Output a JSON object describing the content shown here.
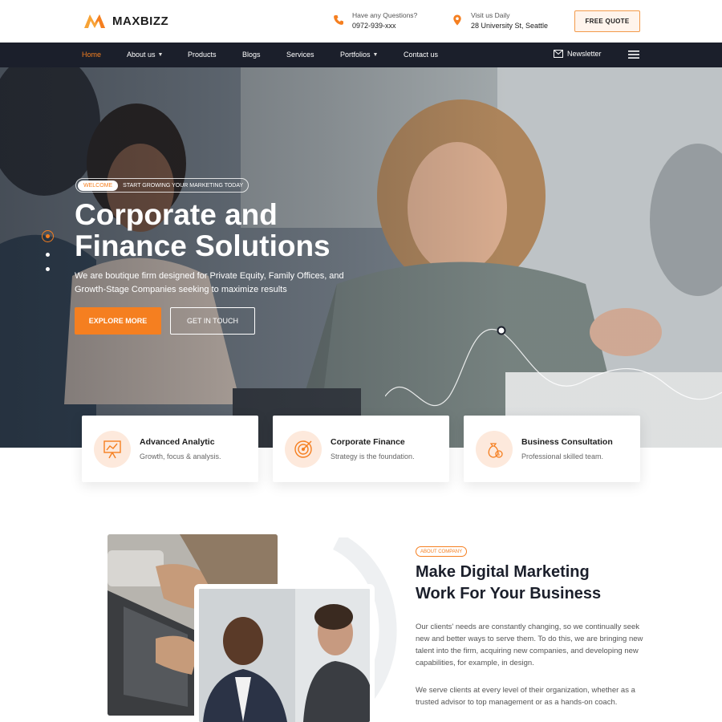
{
  "brand": {
    "name": "MAXBIZZ",
    "accent": "#f57f20",
    "dark": "#1b1f2b"
  },
  "header": {
    "phone": {
      "label": "Have any Questions?",
      "value": "0972-939-xxx",
      "icon": "phone-icon"
    },
    "visit": {
      "label": "Visit us Daily",
      "value": "28 University St, Seattle",
      "icon": "location-pin-icon"
    },
    "quote_label": "FREE QUOTE"
  },
  "nav": {
    "items": [
      {
        "label": "Home",
        "active": true
      },
      {
        "label": "About us",
        "dropdown": true
      },
      {
        "label": "Products"
      },
      {
        "label": "Blogs"
      },
      {
        "label": "Services"
      },
      {
        "label": "Portfolios",
        "dropdown": true
      },
      {
        "label": "Contact us"
      }
    ],
    "newsletter_label": "Newsletter"
  },
  "hero": {
    "tag": "WELCOME",
    "tagline": "START GROWING YOUR MARKETING TODAY",
    "title_line1": "Corporate and",
    "title_line2": "Finance Solutions",
    "subtitle": "We are boutique firm designed for Private Equity, Family Offices, and Growth-Stage Companies seeking to maximize results",
    "primary_cta": "EXPLORE MORE",
    "secondary_cta": "GET IN TOUCH"
  },
  "features": [
    {
      "title": "Advanced Analytic",
      "subtitle": "Growth, focus & analysis.",
      "icon": "analytics-icon"
    },
    {
      "title": "Corporate Finance",
      "subtitle": "Strategy is the foundation.",
      "icon": "target-icon"
    },
    {
      "title": "Business Consultation",
      "subtitle": "Professional skilled team.",
      "icon": "money-bag-icon"
    }
  ],
  "about": {
    "tag": "ABOUT COMPANY",
    "title_line1": "Make Digital Marketing",
    "title_line2": "Work For Your Business",
    "paragraph1": "Our clients' needs are constantly changing, so we continually seek new and better ways to serve them. To do this, we are bringing new talent into the firm, acquiring new companies, and developing new capabilities, for example, in design.",
    "paragraph2": "We serve clients at every level of their organization, whether as a trusted advisor to top management or as a hands-on coach."
  }
}
